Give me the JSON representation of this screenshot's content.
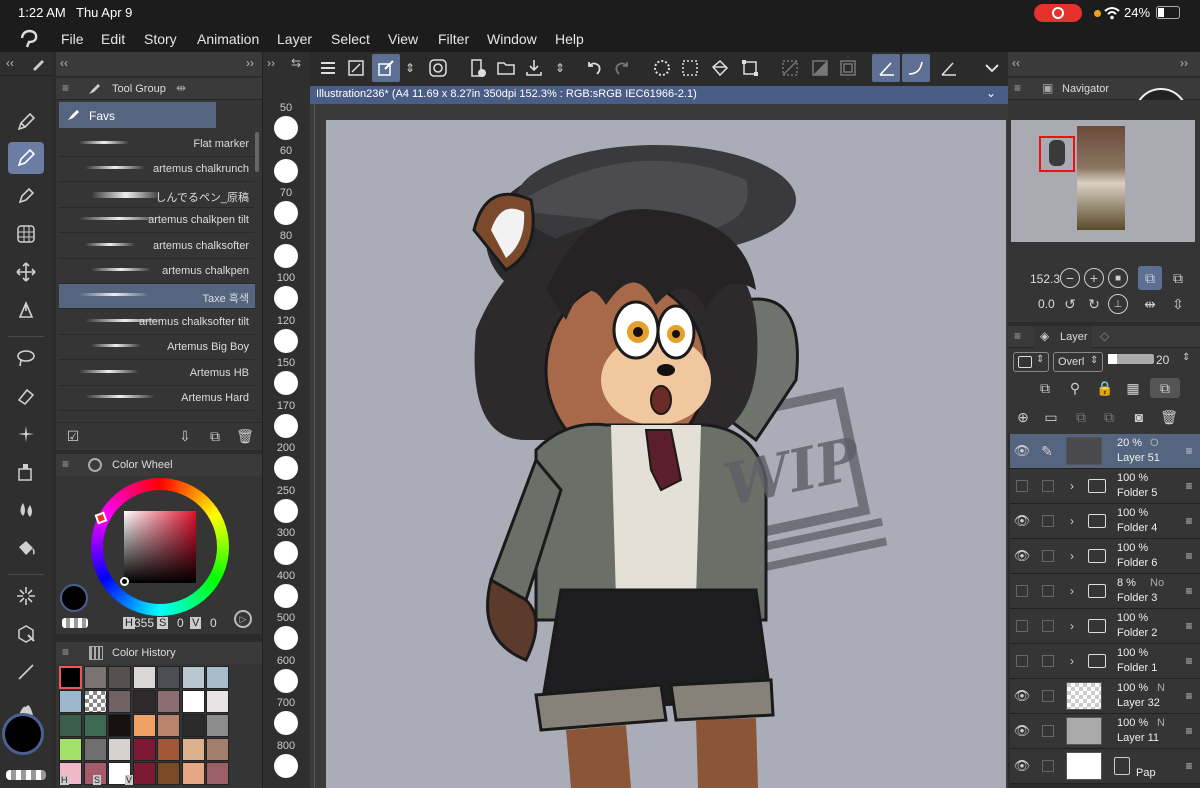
{
  "status": {
    "time": "1:22 AM",
    "date": "Thu Apr 9",
    "battery": "24%"
  },
  "menu": [
    "File",
    "Edit",
    "Story",
    "Animation",
    "Layer",
    "Select",
    "View",
    "Filter",
    "Window",
    "Help"
  ],
  "tool_group": {
    "title": "Tool Group",
    "active_tab": "Favs",
    "brushes": [
      "Flat marker",
      "artemus chalkrunch",
      "しんでるペン_原稿",
      "artemus chalkpen tilt",
      "artemus chalksofter",
      "artemus chalkpen",
      "Taxe 흑색",
      "artemus chalksofter tilt",
      "Artemus Big Boy",
      "Artemus HB",
      "Artemus Hard"
    ],
    "selected_brush": "Taxe 흑색"
  },
  "brush_sizes": [
    "50",
    "60",
    "70",
    "80",
    "100",
    "120",
    "150",
    "170",
    "200",
    "250",
    "300",
    "400",
    "500",
    "600",
    "700",
    "800"
  ],
  "color_wheel": {
    "title": "Color Wheel",
    "h": "355",
    "s": "0",
    "v": "0",
    "h_label": "H",
    "s_label": "S",
    "v_label": "V"
  },
  "color_history": {
    "title": "Color History",
    "swatches": [
      "#000000",
      "#7a7371",
      "#56504f",
      "#d9d6d5",
      "#4b4f55",
      "#b9c7d1",
      "#a7bccb",
      "#9db8cc",
      "checker",
      "#6e6262",
      "#2d2b2c",
      "#8b6e70",
      "#ffffff",
      "#e8e4e5",
      "#3b5e4b",
      "#3f6a52",
      "#16110f",
      "#f0a165",
      "#b9826a",
      "#2b2b2b",
      "#8c8c8c",
      "#a3e06a",
      "#6f6f6f",
      "#d7d2cf",
      "#7d1834",
      "#a25836",
      "#ddb08c",
      "#a27f6e",
      "#f0b8c9",
      "#a65a6c",
      "#ffffff",
      "#7a1b32",
      "#7a4a27",
      "#e7a684",
      "#9b5f66"
    ],
    "hsv_labels": [
      "H",
      "S",
      "V"
    ]
  },
  "document": {
    "tab": "Illustration236* (A4 11.69 x 8.27in 350dpi 152.3% : RGB:sRGB IEC61966-2.1)"
  },
  "canvas": {
    "watermark": "WIP",
    "background": "#aaadb8"
  },
  "navigator": {
    "title": "Navigator",
    "zoom": "152.3",
    "rotation": "0.0"
  },
  "layer_panel": {
    "tab": "Layer",
    "blend_mode": "Overl",
    "opacity": "20",
    "layers": [
      {
        "opacity": "20 %",
        "mode": "O",
        "name": "Layer 51",
        "type": "raster",
        "visible": true,
        "selected": true
      },
      {
        "opacity": "100 %",
        "mode": "",
        "name": "Folder 5",
        "type": "folder",
        "visible": false
      },
      {
        "opacity": "100 %",
        "mode": "",
        "name": "Folder 4",
        "type": "folder",
        "visible": true
      },
      {
        "opacity": "100 %",
        "mode": "",
        "name": "Folder 6",
        "type": "folder",
        "visible": true
      },
      {
        "opacity": "8 %",
        "mode": "No",
        "name": "Folder 3",
        "type": "folder",
        "visible": false
      },
      {
        "opacity": "100 %",
        "mode": "",
        "name": "Folder 2",
        "type": "folder",
        "visible": false
      },
      {
        "opacity": "100 %",
        "mode": "",
        "name": "Folder 1",
        "type": "folder",
        "visible": false
      },
      {
        "opacity": "100 %",
        "mode": "N",
        "name": "Layer 32",
        "type": "checker",
        "visible": true
      },
      {
        "opacity": "100 %",
        "mode": "N",
        "name": "Layer 11",
        "type": "gray",
        "visible": true
      },
      {
        "opacity": "",
        "mode": "",
        "name": "Pap",
        "type": "paper",
        "visible": true
      }
    ]
  },
  "colors": {
    "accent": "#6b7da3",
    "panel": "#353535",
    "selection": "#55647f",
    "record": "#e5322d"
  }
}
